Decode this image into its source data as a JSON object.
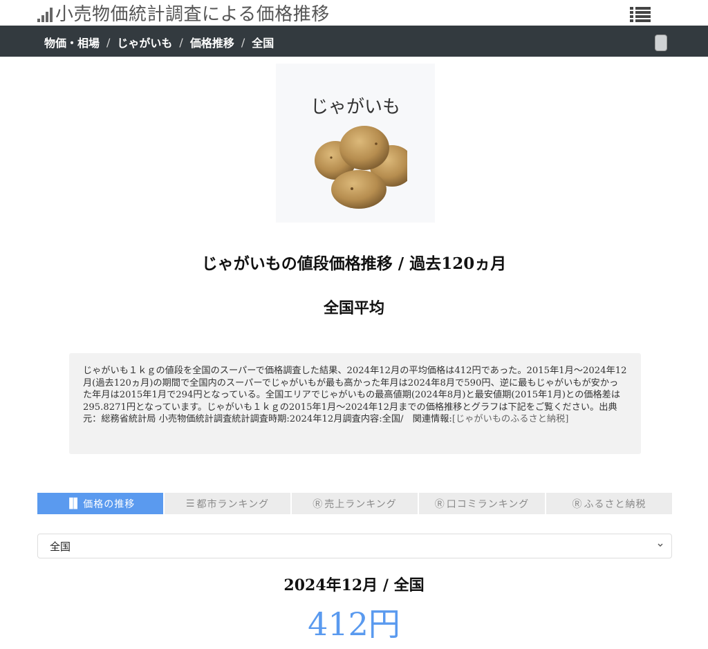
{
  "header": {
    "site_title": "小売物価統計調査による価格推移",
    "logo_icon": "bar-chart-icon",
    "menu_icon": "list-menu-icon"
  },
  "breadcrumb": {
    "items": [
      "物価・相場",
      "じゃがいも",
      "価格推移",
      "全国"
    ],
    "separator": "/"
  },
  "product": {
    "name": "じゃがいも",
    "image_icon": "potato-image"
  },
  "page": {
    "title": "じゃがいもの値段価格推移 / 過去120ヵ月",
    "region_heading": "全国平均"
  },
  "summary": {
    "text": "じゃがいも１ｋｇの値段を全国のスーパーで価格調査した結果、2024年12月の平均価格は412円であった。2015年1月〜2024年12月(過去120ヵ月)の期間で全国内のスーパーでじゃがいもが最も高かった年月は2024年8月で590円、逆に最もじゃがいもが安かった年月は2015年1月で294円となっている。全国エリアでじゃがいもの最高値期(2024年8月)と最安値期(2015年1月)との価格差は295.8271円となっています。じゃがいも１ｋｇの2015年1月〜2024年12月までの価格推移とグラフは下記をご覧ください。出典元：総務省統計局 小売物価統計調査統計調査時期:2024年12月調査内容:全国/　関連情報:",
    "link_text": "[じゃがいものふるさと納税]"
  },
  "tabs": [
    {
      "icon": "▐▌",
      "label": "価格の推移",
      "active": true
    },
    {
      "icon": "☰",
      "label": "都市ランキング",
      "active": false
    },
    {
      "icon": "Ⓡ",
      "label": "売上ランキング",
      "active": false
    },
    {
      "icon": "Ⓡ",
      "label": "口コミランキング",
      "active": false
    },
    {
      "icon": "Ⓡ",
      "label": "ふるさと納税",
      "active": false
    }
  ],
  "region_select": {
    "selected": "全国"
  },
  "result": {
    "period_region": "2024年12月 / 全国",
    "price": "412円"
  },
  "colors": {
    "accent": "#5a9aef",
    "navbar": "#333a3f",
    "tab_inactive": "#ececec",
    "summary_bg": "#f2f2f2"
  }
}
